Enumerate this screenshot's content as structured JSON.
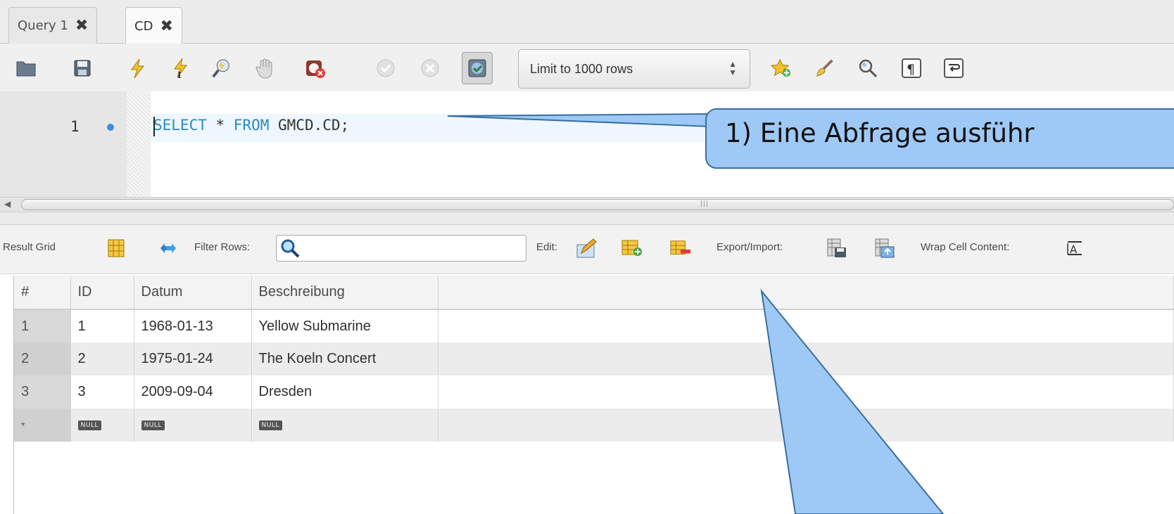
{
  "tabs": [
    {
      "label": "Query 1",
      "close": "✖"
    },
    {
      "label": "CD",
      "close": "✖"
    }
  ],
  "toolbar": {
    "limit_label": "Limit to 1000 rows",
    "icons": [
      "open-folder-icon",
      "save-icon",
      "execute-icon",
      "execute-current-icon",
      "explain-icon",
      "stop-icon",
      "toggle-continue-on-error-icon",
      "commit-icon",
      "rollback-icon",
      "autocommit-icon",
      "add-snippet-icon",
      "beautify-icon",
      "find-icon",
      "invisible-chars-icon",
      "word-wrap-icon"
    ]
  },
  "editor": {
    "line_number": "1",
    "code": {
      "kw1": "SELECT",
      "star": " * ",
      "kw2": "FROM",
      "rest": " GMCD.CD;"
    }
  },
  "result_toolbar": {
    "result_grid": "Result Grid",
    "filter_rows": "Filter Rows:",
    "edit": "Edit:",
    "export_import": "Export/Import:",
    "wrap_cell": "Wrap Cell Content:",
    "filter_value": ""
  },
  "grid": {
    "headers": [
      "#",
      "ID",
      "Datum",
      "Beschreibung"
    ],
    "rows": [
      [
        "1",
        "1",
        "1968-01-13",
        "Yellow Submarine"
      ],
      [
        "2",
        "2",
        "1975-01-24",
        "The Koeln Concert"
      ],
      [
        "3",
        "3",
        "2009-09-04",
        "Dresden"
      ]
    ],
    "new_row": {
      "marker": "*",
      "null_label": "NULL"
    }
  },
  "callout": {
    "text": "1) Eine Abfrage ausführ"
  },
  "colors": {
    "callout_fill": "#9ec9f7",
    "callout_stroke": "#3b6e9e",
    "keyword": "#2a8abf"
  }
}
